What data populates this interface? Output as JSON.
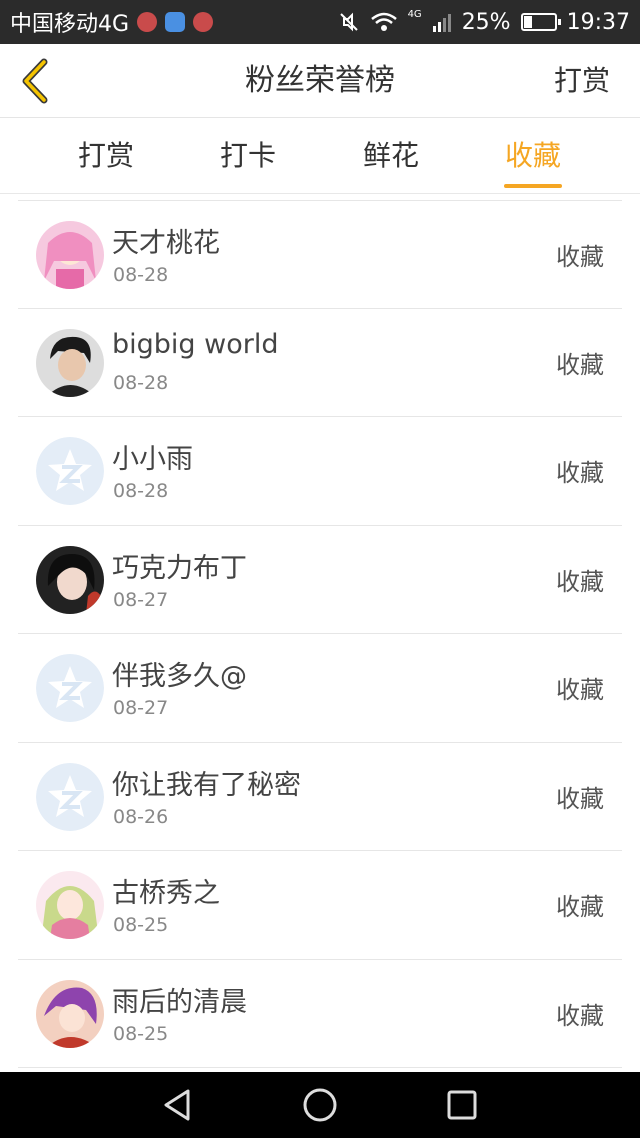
{
  "status_bar": {
    "carrier": "中国移动4G",
    "network": "4G",
    "battery": "25%",
    "battery_level": 0.25,
    "time": "19:37"
  },
  "header": {
    "title": "粉丝荣誉榜",
    "action": "打赏",
    "back_icon": "chevron-left-icon"
  },
  "tabs": [
    {
      "label": "打赏"
    },
    {
      "label": "打卡"
    },
    {
      "label": "鲜花"
    },
    {
      "label": "收藏"
    }
  ],
  "active_tab_index": 3,
  "accent_color": "#f5a623",
  "list": [
    {
      "name": "天才桃花",
      "date": "08-28",
      "action": "收藏",
      "avatar": "anime-girl-pink"
    },
    {
      "name": "bigbig world",
      "date": "08-28",
      "action": "收藏",
      "avatar": "photo-man"
    },
    {
      "name": "小小雨",
      "date": "08-28",
      "action": "收藏",
      "avatar": "default-star"
    },
    {
      "name": "巧克力布丁",
      "date": "08-27",
      "action": "收藏",
      "avatar": "photo-girl"
    },
    {
      "name": "伴我多久@",
      "date": "08-27",
      "action": "收藏",
      "avatar": "default-star"
    },
    {
      "name": "你让我有了秘密",
      "date": "08-26",
      "action": "收藏",
      "avatar": "default-star"
    },
    {
      "name": "古桥秀之",
      "date": "08-25",
      "action": "收藏",
      "avatar": "anime-girl-green"
    },
    {
      "name": "雨后的清晨",
      "date": "08-25",
      "action": "收藏",
      "avatar": "anime-girl-purple"
    }
  ]
}
